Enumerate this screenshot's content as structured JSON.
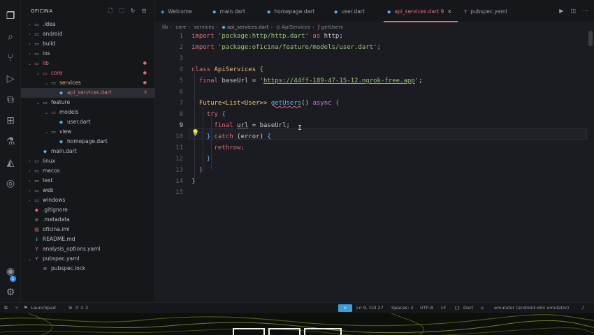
{
  "explorer": {
    "title": "OFICINA",
    "items": [
      {
        "label": ".idea",
        "kind": "folder"
      },
      {
        "label": "android",
        "kind": "folder"
      },
      {
        "label": "build",
        "kind": "folder"
      },
      {
        "label": "ios",
        "kind": "folder"
      },
      {
        "label": "lib",
        "kind": "folder-open"
      },
      {
        "label": "core",
        "kind": "folder-open"
      },
      {
        "label": "services",
        "kind": "folder-open"
      },
      {
        "label": "api_services.dart",
        "kind": "dart",
        "badge": "9+"
      },
      {
        "label": "feature",
        "kind": "folder-open"
      },
      {
        "label": "models",
        "kind": "folder-open"
      },
      {
        "label": "user.dart",
        "kind": "dart"
      },
      {
        "label": "view",
        "kind": "folder-open"
      },
      {
        "label": "homepage.dart",
        "kind": "dart"
      },
      {
        "label": "main.dart",
        "kind": "dart"
      },
      {
        "label": "linux",
        "kind": "folder"
      },
      {
        "label": "macos",
        "kind": "folder"
      },
      {
        "label": "test",
        "kind": "folder"
      },
      {
        "label": "web",
        "kind": "folder"
      },
      {
        "label": "windows",
        "kind": "folder"
      },
      {
        "label": ".gitignore",
        "kind": "file"
      },
      {
        "label": ".metadata",
        "kind": "file"
      },
      {
        "label": "oficina.iml",
        "kind": "file"
      },
      {
        "label": "README.md",
        "kind": "file"
      },
      {
        "label": "analysis_options.yaml",
        "kind": "file"
      },
      {
        "label": "pubspec.yaml",
        "kind": "file"
      },
      {
        "label": "pubspec.lock",
        "kind": "file"
      }
    ]
  },
  "tabs": [
    {
      "label": "Welcome"
    },
    {
      "label": "main.dart"
    },
    {
      "label": "homepage.dart"
    },
    {
      "label": "user.dart"
    },
    {
      "label": "api_services.dart 9",
      "active": true
    },
    {
      "label": "pubspec.yaml"
    }
  ],
  "breadcrumb": {
    "parts": [
      "lib",
      "core",
      "services",
      "api_services.dart",
      "ApiServices",
      "getUsers"
    ]
  },
  "code": {
    "line_numbers": [
      "1",
      "2",
      "3",
      "4",
      "5",
      "6",
      "7",
      "8",
      "9",
      "10",
      "11",
      "12",
      "13",
      "14",
      "15"
    ],
    "current_line": "9",
    "import1_kw": "import",
    "import1_str": "'package:http/http.dart'",
    "import1_as": "as",
    "import1_alias": "http;",
    "import2_kw": "import",
    "import2_str": "'package:oficina/feature/models/user.dart';",
    "class_kw": "class",
    "class_name": "ApiServices",
    "final_kw": "final",
    "baseurl_name": "baseUrl",
    "url_value": "https://44ff-189-47-15-12.ngrok-free.app",
    "future_type": "Future<List<User>>",
    "fn_name": "getUsers",
    "async_kw": "async",
    "try_kw": "try",
    "url_var": "url",
    "baseurl_ref": "baseUrl;",
    "catch_kw": "catch",
    "error_var": "error",
    "rethrow_kw": "rethrow;"
  },
  "statusbar": {
    "launchpad": "Launchpad",
    "problems": "0 ⚠ 2",
    "position": "Ln 9, Col 27",
    "spaces": "Spaces: 2",
    "encoding": "UTF-8",
    "eol": "LF",
    "language": "Dart",
    "device": "emulator (android-x64 emulator)"
  },
  "colors": {
    "accent": "#e06c75",
    "background": "#1b1c21",
    "status_highlight": "#3a9fd6"
  }
}
